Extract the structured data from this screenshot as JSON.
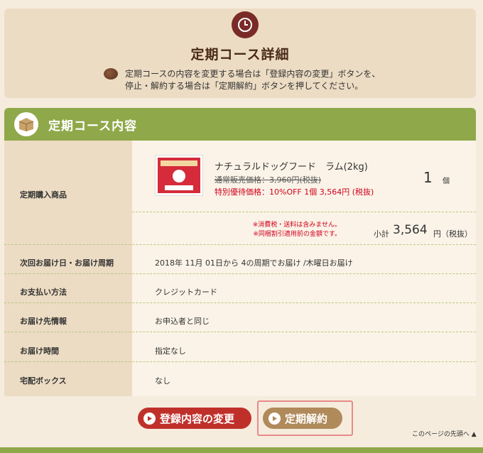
{
  "header": {
    "title": "定期コース詳細",
    "notice_line1": "定期コースの内容を変更する場合は「登録内容の変更」ボタンを、",
    "notice_line2": "停止・解約する場合は「定期解約」ボタンを押してください。"
  },
  "section": {
    "title": "定期コース内容"
  },
  "product": {
    "row_label": "定期購入商品",
    "name": "ナチュラルドッグフード　ラム(2kg)",
    "regular_price": "通常販売価格：3,960円(税抜)",
    "special_price": "特別優待価格：10%OFF 1個 3,564円 (税抜)",
    "quantity": "1",
    "quantity_unit": "個",
    "note1": "※消費税・送料は含みません。",
    "note2": "※同梱割引適用前の金額です。",
    "subtotal_label": "小計",
    "subtotal_value": "3,564",
    "subtotal_unit": "円（税抜）"
  },
  "rows": [
    {
      "label": "次回お届け日・お届け周期",
      "value": "2018年 11月 01日から 4の周期でお届け /木曜日お届け"
    },
    {
      "label": "お支払い方法",
      "value": "クレジットカード"
    },
    {
      "label": "お届け先情報",
      "value": "お申込者と同じ"
    },
    {
      "label": "お届け時間",
      "value": "指定なし"
    },
    {
      "label": "宅配ボックス",
      "value": "なし"
    }
  ],
  "buttons": {
    "change": "登録内容の変更",
    "cancel": "定期解約"
  },
  "to_top": "このページの先頭へ",
  "colors": {
    "accent_green": "#8fa84a",
    "accent_red": "#c0302a",
    "button_brown": "#b08a5a",
    "title_brown": "#7a2b27"
  }
}
